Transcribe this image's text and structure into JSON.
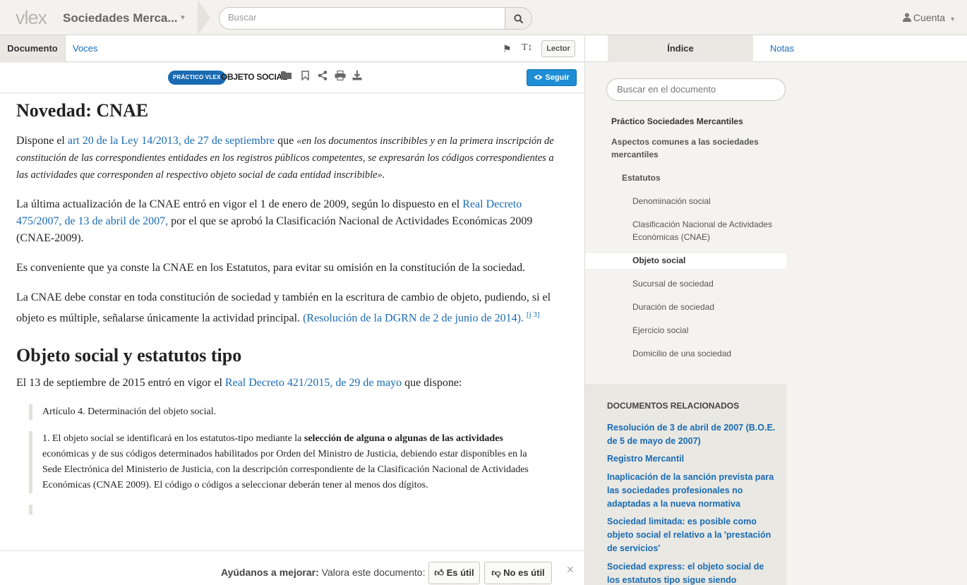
{
  "header": {
    "logo": "vlex",
    "app_title": "Sociedades Merca...",
    "search_placeholder": "Buscar",
    "account_label": "Cuenta"
  },
  "doc_tabs": {
    "documento": "Documento",
    "voces": "Voces",
    "textsize": "T↕",
    "lector": "Lector"
  },
  "toolbar": {
    "badge": "PRÁCTICO VLEX",
    "title": "OBJETO SOCIAL",
    "seguir": "Seguir"
  },
  "content": {
    "h1": "Novedad: CNAE",
    "p1_a": "Dispone el ",
    "p1_link": "art 20 de la Ley 14/2013, de 27 de septiembre",
    "p1_b": " que ",
    "p1_quote": "«en los documentos inscribibles y en la primera inscripción de constitución de las correspondientes entidades en los registros públicos competentes, se expresarán los códigos correspondientes a las actividades que corresponden al respectivo objeto social de cada entidad inscribible».",
    "p2_a": "La última actualización de la CNAE entró en vigor el 1 de enero de 2009, según lo dispuesto en el ",
    "p2_link": "Real Decreto 475/2007, de 13 de abril de 2007,",
    "p2_b": " por el que se aprobó la Clasificación Nacional de Actividades Económicas 2009 (CNAE-2009).",
    "p3": "Es conveniente que ya conste la CNAE en los Estatutos, para evitar su omisión en la constitución de la sociedad.",
    "p4_a": "La CNAE debe constar en toda constitución de sociedad y también en la escritura de cambio de objeto, pudiendo, si el objeto es múltiple, señalarse únicamente la actividad principal. ",
    "p4_link": "(Resolución de la DGRN de 2 de junio de 2014).",
    "p4_sup": "[j 3]",
    "h2": "Objeto social y estatutos tipo",
    "p5_a": "El 13 de septiembre de 2015 entró en vigor el ",
    "p5_link": "Real Decreto 421/2015, de 29 de mayo",
    "p5_b": " que dispone:",
    "q1": "Artículo 4. Determinación del objeto social.",
    "q2_a": "1. El objeto social se identificará en los estatutos-tipo mediante la ",
    "q2_bold": "selección de alguna o algunas de las actividades",
    "q2_b": " económicas y de sus códigos determinados habilitados por Orden del Ministro de Justicia, debiendo estar disponibles en la Sede Electrónica del Ministerio de Justicia, con la descripción correspondiente de la Clasificación Nacional de Actividades Económicas (CNAE 2009). El código o códigos a seleccionar deberán tener al menos dos dígitos."
  },
  "feedback": {
    "label_bold": "Ayúdanos a mejorar:",
    "label": " Valora este documento:",
    "useful": "Es útil",
    "not_useful": "No es útil"
  },
  "sidebar": {
    "tab_indice": "Índice",
    "tab_notas": "Notas",
    "search_placeholder": "Buscar en el documento",
    "toc": {
      "root": "Práctico Sociedades Mercantiles",
      "section": "Aspectos comunes a las sociedades mercantiles",
      "subsection": "Estatutos",
      "items": [
        "Denominación social",
        "Clasificación Nacional de Actividades Económicas (CNAE)",
        "Objeto social",
        "Sucursal de sociedad",
        "Duración de sociedad",
        "Ejercicio social",
        "Domicilio de una sociedad"
      ]
    },
    "related": {
      "title": "DOCUMENTOS RELACIONADOS",
      "links": [
        "Resolución de 3 de abril de 2007 (B.O.E. de 5 de mayo de 2007)",
        "Registro Mercantil",
        "Inaplicación de la sanción prevista para las sociedades profesionales no adaptadas a la nueva normativa",
        "Sociedad limitada: es posible como objeto social el relativo a la 'prestación de servicios'",
        "Sociedad express: el objeto social de los estatutos tipo sigue siendo"
      ]
    }
  }
}
